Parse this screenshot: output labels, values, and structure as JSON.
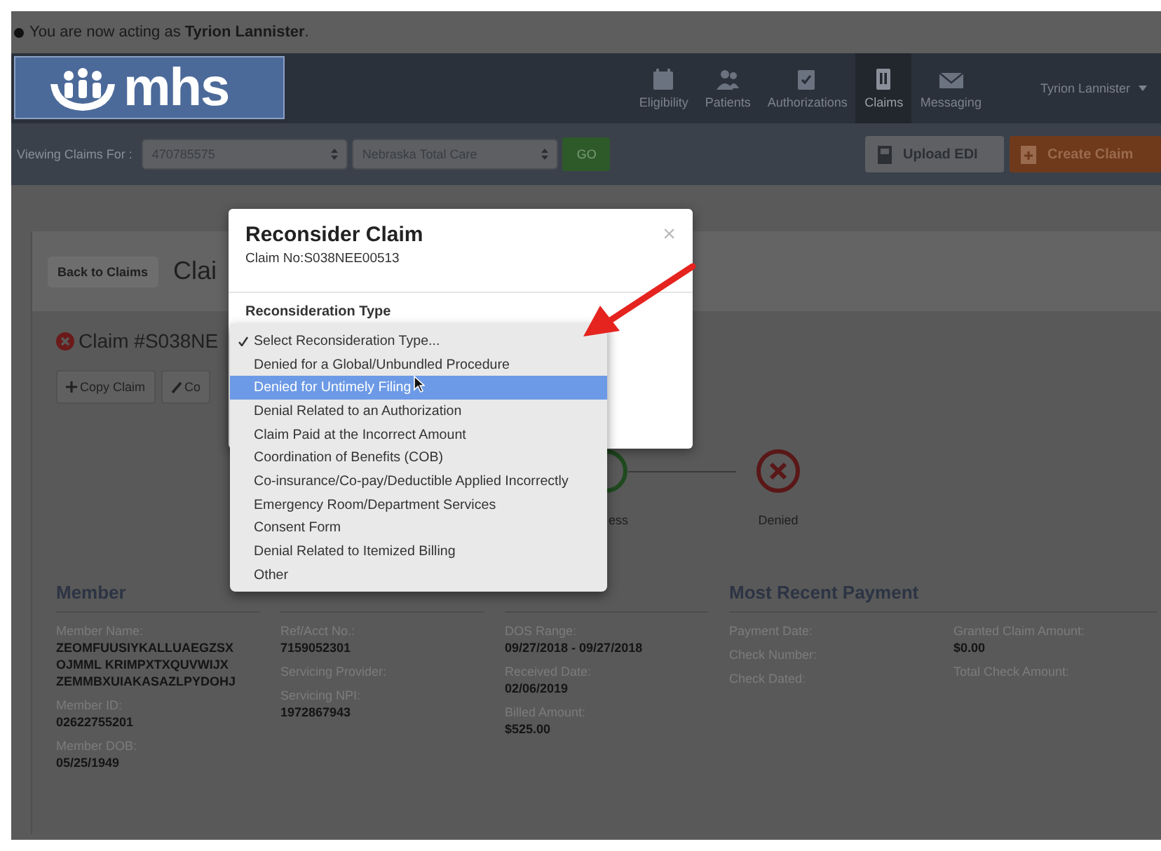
{
  "notice": {
    "text": "You are now acting as **Tyrion Lannister**."
  },
  "navbar": {
    "logo": "mhs",
    "items": [
      {
        "label": "Eligibility",
        "selected": false
      },
      {
        "label": "Patients",
        "selected": false
      },
      {
        "label": "Authorizations",
        "selected": false
      },
      {
        "label": "Claims",
        "selected": true
      },
      {
        "label": "Messaging",
        "selected": false
      }
    ],
    "user": "Tyrion Lannister"
  },
  "filter_bar": {
    "label": "Viewing Claims For :",
    "account": "470785575",
    "plan": "Nebraska Total Care",
    "go": "GO",
    "buttons": [
      {
        "label": "Upload EDI",
        "kind": "secondary"
      },
      {
        "label": "Create Claim",
        "kind": "primary"
      }
    ]
  },
  "claim_page": {
    "back_button": "Back to Claims",
    "title": "Clai",
    "claim_heading": "Claim #S038NE",
    "actions": [
      {
        "label": "Copy Claim",
        "kind": "add"
      },
      {
        "label": "Co",
        "kind": "edit"
      }
    ],
    "status_steps": [
      {
        "label": "ess",
        "kind": "done"
      },
      {
        "label": "Denied",
        "kind": "denied"
      }
    ],
    "sections": [
      {
        "title": "Member",
        "columns": [
          [
            {
              "label": "Member Name:",
              "lines": [
                "ZEOMFUUSIYKALLUAEGZSX",
                "OJMML KRIMPXTXQUVWIJX",
                "ZEMMBXUIAKASAZLPYDOHJ"
              ]
            },
            {
              "label": "Member ID:",
              "lines": [
                "02622755201"
              ]
            },
            {
              "label": "Member DOB:",
              "lines": [
                "05/25/1949"
              ]
            }
          ]
        ]
      },
      {
        "columns": [
          [
            {
              "label": "Ref/Acct No.:",
              "lines": [
                "7159052301"
              ]
            },
            {
              "label": "Servicing Provider:"
            },
            {
              "label": "Servicing NPI:",
              "lines": [
                "1972867943"
              ]
            }
          ]
        ]
      },
      {
        "columns": [
          [
            {
              "label": "DOS Range:",
              "lines": [
                "09/27/2018 - 09/27/2018"
              ]
            },
            {
              "label": "Received Date:",
              "lines": [
                "02/06/2019"
              ]
            },
            {
              "label": "Billed Amount:",
              "lines": [
                "$525.00"
              ]
            }
          ]
        ]
      },
      {
        "title": "Most Recent Payment",
        "columns": [
          [
            {
              "label": "Payment Date:"
            },
            {
              "label": "Check Number:"
            },
            {
              "label": "Check Dated:"
            }
          ],
          [
            {
              "label": "Granted Claim Amount:",
              "lines": [
                "$0.00"
              ]
            },
            {
              "label": "Total Check Amount:"
            }
          ]
        ]
      }
    ]
  },
  "modal": {
    "title": "Reconsider Claim",
    "subtitle": "Claim No:S038NEE00513",
    "field_label": "Reconsideration Type",
    "close": "×"
  },
  "dropdown": {
    "options": [
      {
        "label": "Select Reconsideration Type...",
        "checked": true,
        "selected": false
      },
      {
        "label": "Denied for a Global/Unbundled Procedure",
        "checked": false,
        "selected": false
      },
      {
        "label": "Denied for Untimely Filing",
        "checked": false,
        "selected": true
      },
      {
        "label": "Denial Related to an Authorization",
        "checked": false,
        "selected": false
      },
      {
        "label": "Claim Paid at the Incorrect Amount",
        "checked": false,
        "selected": false
      },
      {
        "label": "Coordination of Benefits (COB)",
        "checked": false,
        "selected": false
      },
      {
        "label": "Co-insurance/Co-pay/Deductible Applied Incorrectly",
        "checked": false,
        "selected": false
      },
      {
        "label": "Emergency Room/Department Services",
        "checked": false,
        "selected": false
      },
      {
        "label": "Consent Form",
        "checked": false,
        "selected": false
      },
      {
        "label": "Denial Related to Itemized Billing",
        "checked": false,
        "selected": false
      },
      {
        "label": "Other",
        "checked": false,
        "selected": false
      }
    ]
  }
}
